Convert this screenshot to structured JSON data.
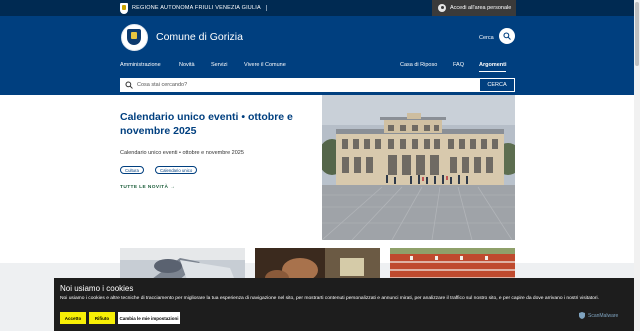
{
  "top_bar": {
    "region_name": "REGIONE AUTONOMA FRIULI VENEZIA GIULIA",
    "login_label": "Accedi all'area personale"
  },
  "header": {
    "site_title": "Comune di Gorizia",
    "search_label": "Cerca"
  },
  "nav": {
    "left": [
      "Amministrazione",
      "Novità",
      "Servizi",
      "Vivere il Comune"
    ],
    "right": [
      "Casa di Riposo",
      "FAQ",
      "Argomenti"
    ]
  },
  "search_bar": {
    "placeholder": "Cosa stai cercando?",
    "button_label": "CERCA"
  },
  "hero": {
    "title": "Calendario unico eventi • ottobre e novembre 2025",
    "description": "Calendario unico eventi • ottobre e novembre 2025",
    "tags": [
      "Cultura",
      "Calendario unico"
    ],
    "all_news_label": "TUTTE LE NOVITÀ"
  },
  "cookie_banner": {
    "title": "Noi usiamo i cookies",
    "text": "Noi usiamo i cookies e altre tecniche di tracciamento per migliorare la tua esperienza di navigazione nel sito, per mostrarti contenuti personalizzati e annunci mirati, per analizzare il traffico sul nostro sito, e per capire da dove arrivano i nostri visitatori.",
    "accept_label": "Accetto",
    "reject_label": "Rifiuto",
    "settings_label": "Cambia le mie impostazioni",
    "badge": "ScanMalware"
  },
  "colors": {
    "primary": "#003f7f",
    "top_bar": "#002a52",
    "cookie_bg": "#1d1d1d",
    "cookie_button": "#f7ef06"
  }
}
